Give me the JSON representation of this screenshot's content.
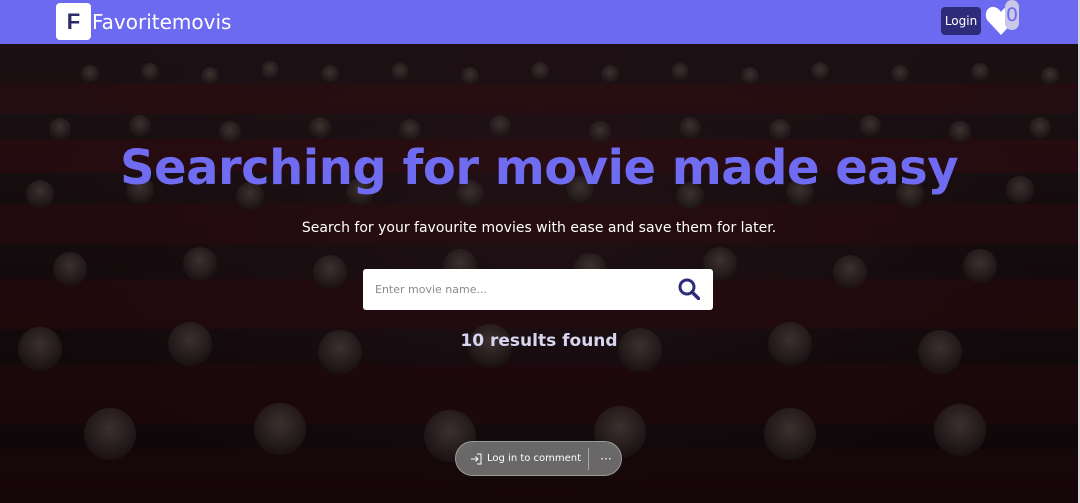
{
  "navbar": {
    "brand_letter": "F",
    "brand_name": "Favoritemovis",
    "login_label": "Login",
    "favorites_count": "0",
    "background_color": "#6c6af0"
  },
  "hero": {
    "headline": "Searching for movie made easy",
    "subline": "Search for your favourite movies with ease and save them for later.",
    "headline_color": "#6f6cf2"
  },
  "search": {
    "placeholder": "Enter movie name...",
    "value": ""
  },
  "results": {
    "text": "10 results found"
  },
  "comment_bar": {
    "login_label": "Log in to comment",
    "more_label": "···"
  }
}
